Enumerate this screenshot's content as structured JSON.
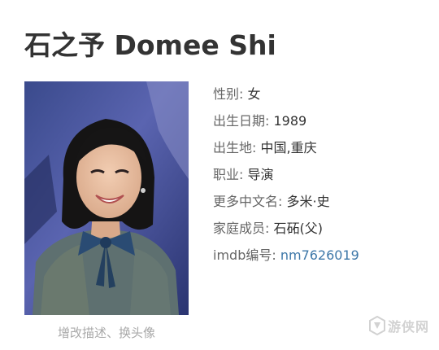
{
  "page": {
    "title": "石之予 Domee Shi"
  },
  "photo": {
    "caption": "增改描述、换头像"
  },
  "info": [
    {
      "label": "性别",
      "value": "女",
      "is_link": false
    },
    {
      "label": "出生日期",
      "value": "1989",
      "is_link": false
    },
    {
      "label": "出生地",
      "value": "中国,重庆",
      "is_link": false
    },
    {
      "label": "职业",
      "value": "导演",
      "is_link": false
    },
    {
      "label": "更多中文名",
      "value": "多米·史",
      "is_link": false
    },
    {
      "label": "家庭成员",
      "value": "石砳(父)",
      "is_link": false
    },
    {
      "label": "imdb编号",
      "value": "nm7626019",
      "is_link": true
    }
  ],
  "watermark": {
    "text": "游侠网"
  },
  "colors": {
    "title": "#333333",
    "label": "#666666",
    "link": "#3d77a8",
    "caption": "#a8a8a8"
  }
}
